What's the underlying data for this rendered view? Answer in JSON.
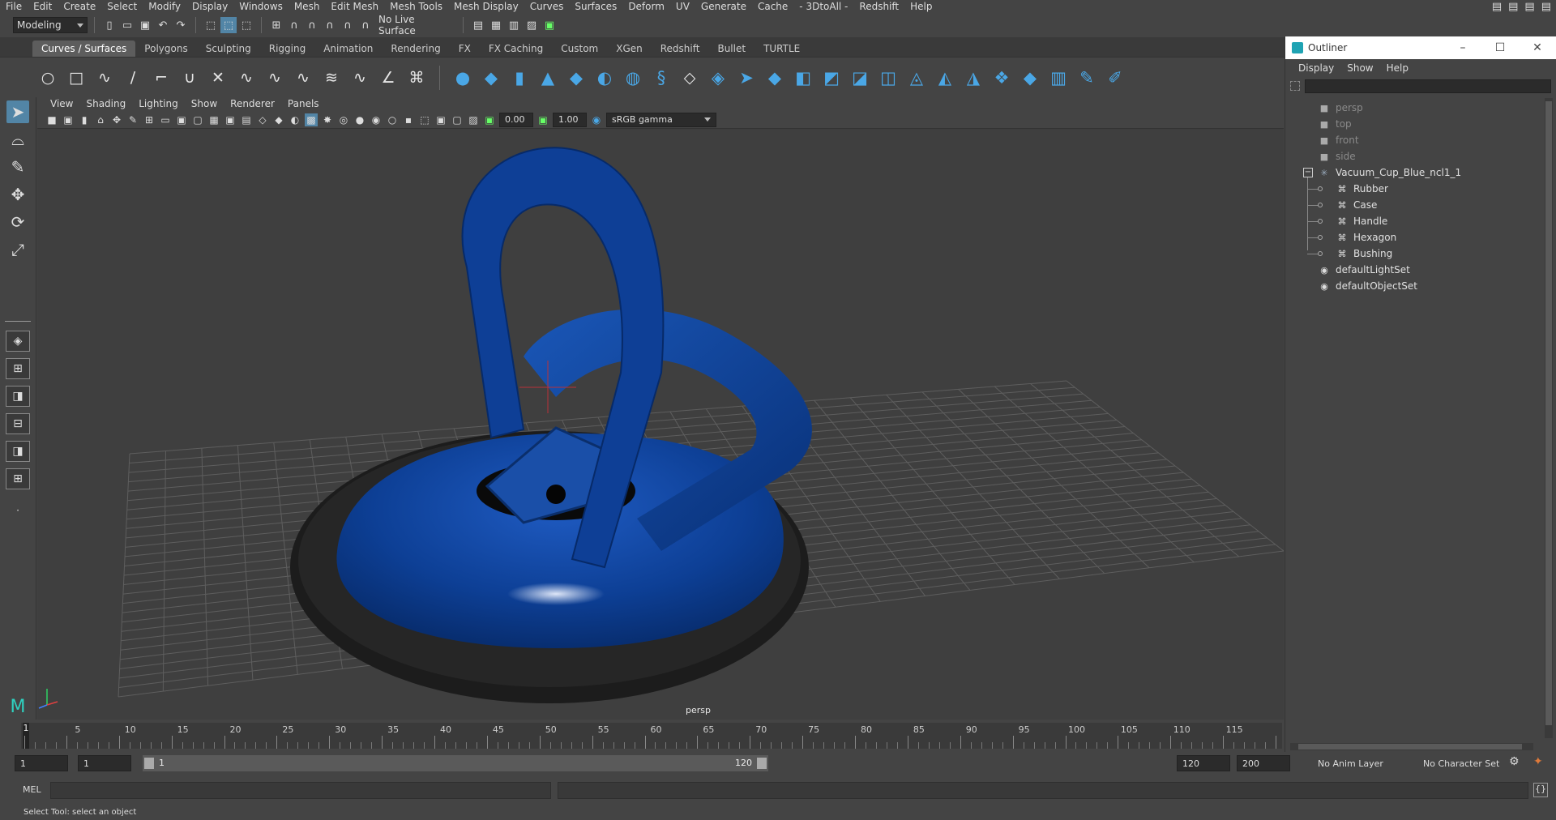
{
  "menubar": {
    "items": [
      "File",
      "Edit",
      "Create",
      "Select",
      "Modify",
      "Display",
      "Windows",
      "Mesh",
      "Edit Mesh",
      "Mesh Tools",
      "Mesh Display",
      "Curves",
      "Surfaces",
      "Deform",
      "UV",
      "Generate",
      "Cache",
      "- 3DtoAll -",
      "Redshift",
      "Help"
    ]
  },
  "statusline": {
    "mode": "Modeling",
    "live_surface": "No Live Surface"
  },
  "shelf": {
    "tabs": [
      "Curves / Surfaces",
      "Polygons",
      "Sculpting",
      "Rigging",
      "Animation",
      "Rendering",
      "FX",
      "FX Caching",
      "Custom",
      "XGen",
      "Redshift",
      "Bullet",
      "TURTLE"
    ],
    "active_tab": "Curves / Surfaces"
  },
  "viewport": {
    "menu": [
      "View",
      "Shading",
      "Lighting",
      "Show",
      "Renderer",
      "Panels"
    ],
    "exposure": "0.00",
    "gamma_value": "1.00",
    "color_space": "sRGB gamma",
    "camera_label": "persp"
  },
  "outliner": {
    "title": "Outliner",
    "menu": [
      "Display",
      "Show",
      "Help"
    ],
    "cameras": [
      "persp",
      "top",
      "front",
      "side"
    ],
    "group": "Vacuum_Cup_Blue_ncl1_1",
    "group_children": [
      "Rubber",
      "Case",
      "Handle",
      "Hexagon",
      "Bushing"
    ],
    "sets": [
      "defaultLightSet",
      "defaultObjectSet"
    ],
    "expander": "−"
  },
  "timeslider": {
    "labels": [
      "1",
      "5",
      "10",
      "15",
      "20",
      "25",
      "30",
      "35",
      "40",
      "45",
      "50",
      "55",
      "60",
      "65",
      "70",
      "75",
      "80",
      "85",
      "90",
      "95",
      "100",
      "105",
      "110",
      "115"
    ],
    "current_frame": "1"
  },
  "range": {
    "start": "1",
    "playback_start": "1",
    "range_start": "1",
    "range_end": "120",
    "playback_end": "120",
    "end": "200",
    "anim_layer": "No Anim Layer",
    "character_set": "No Character Set"
  },
  "commandline": {
    "label": "MEL"
  },
  "helpline": {
    "text": "Select Tool: select an object"
  },
  "colors": {
    "accent": "#5285a6",
    "object": "#0a3d8c"
  }
}
